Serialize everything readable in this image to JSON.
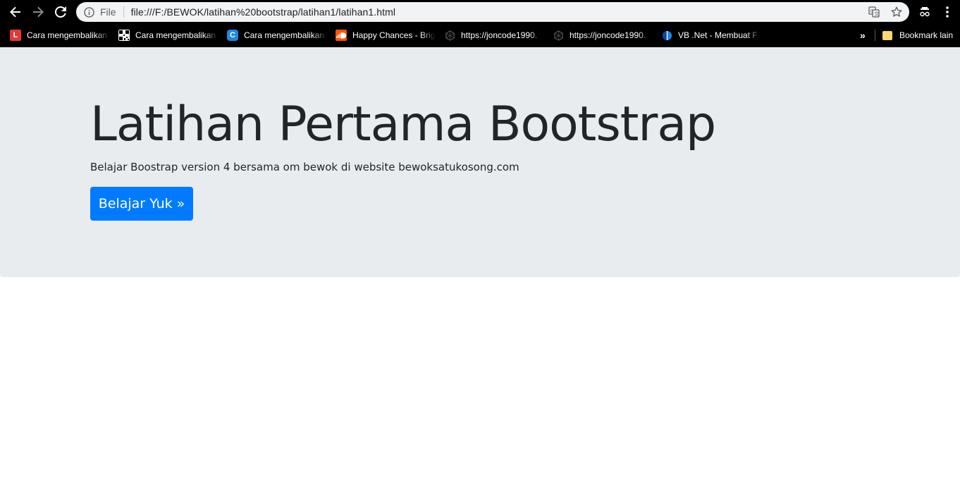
{
  "browser": {
    "address_bar": {
      "scheme_label": "File",
      "url": "file:///F:/BEWOK/latihan%20bootstrap/latihan1/latihan1.html"
    },
    "bookmarks": [
      {
        "label": "Cara mengembalikan",
        "icon": "red-l-favicon",
        "color": "#e53935"
      },
      {
        "label": "Cara mengembalikan",
        "icon": "qr-code-favicon",
        "color": "#ffffff"
      },
      {
        "label": "Cara mengembalikan",
        "icon": "blue-c-favicon",
        "color": "#1e88e5"
      },
      {
        "label": "Happy Chances - Brig",
        "icon": "soundcloud-favicon",
        "color": "#ff5500"
      },
      {
        "label": "https://joncode1990.",
        "icon": "hexagon-favicon",
        "color": "#555555"
      },
      {
        "label": "https://joncode1990.",
        "icon": "hexagon-favicon",
        "color": "#555555"
      },
      {
        "label": "VB .Net - Membuat F",
        "icon": "blue-half-circle-favicon",
        "color": "#1e88e5"
      }
    ],
    "more_bookmarks_label": "»",
    "other_bookmarks_label": "Bookmark lain"
  },
  "page": {
    "title": "Latihan Pertama Bootstrap",
    "lead": "Belajar Boostrap version 4 bersama om bewok di website bewoksatukosong.com",
    "button_label": "Belajar Yuk »"
  },
  "colors": {
    "jumbotron_bg": "#e9ecef",
    "primary": "#007bff",
    "text": "#212529"
  }
}
